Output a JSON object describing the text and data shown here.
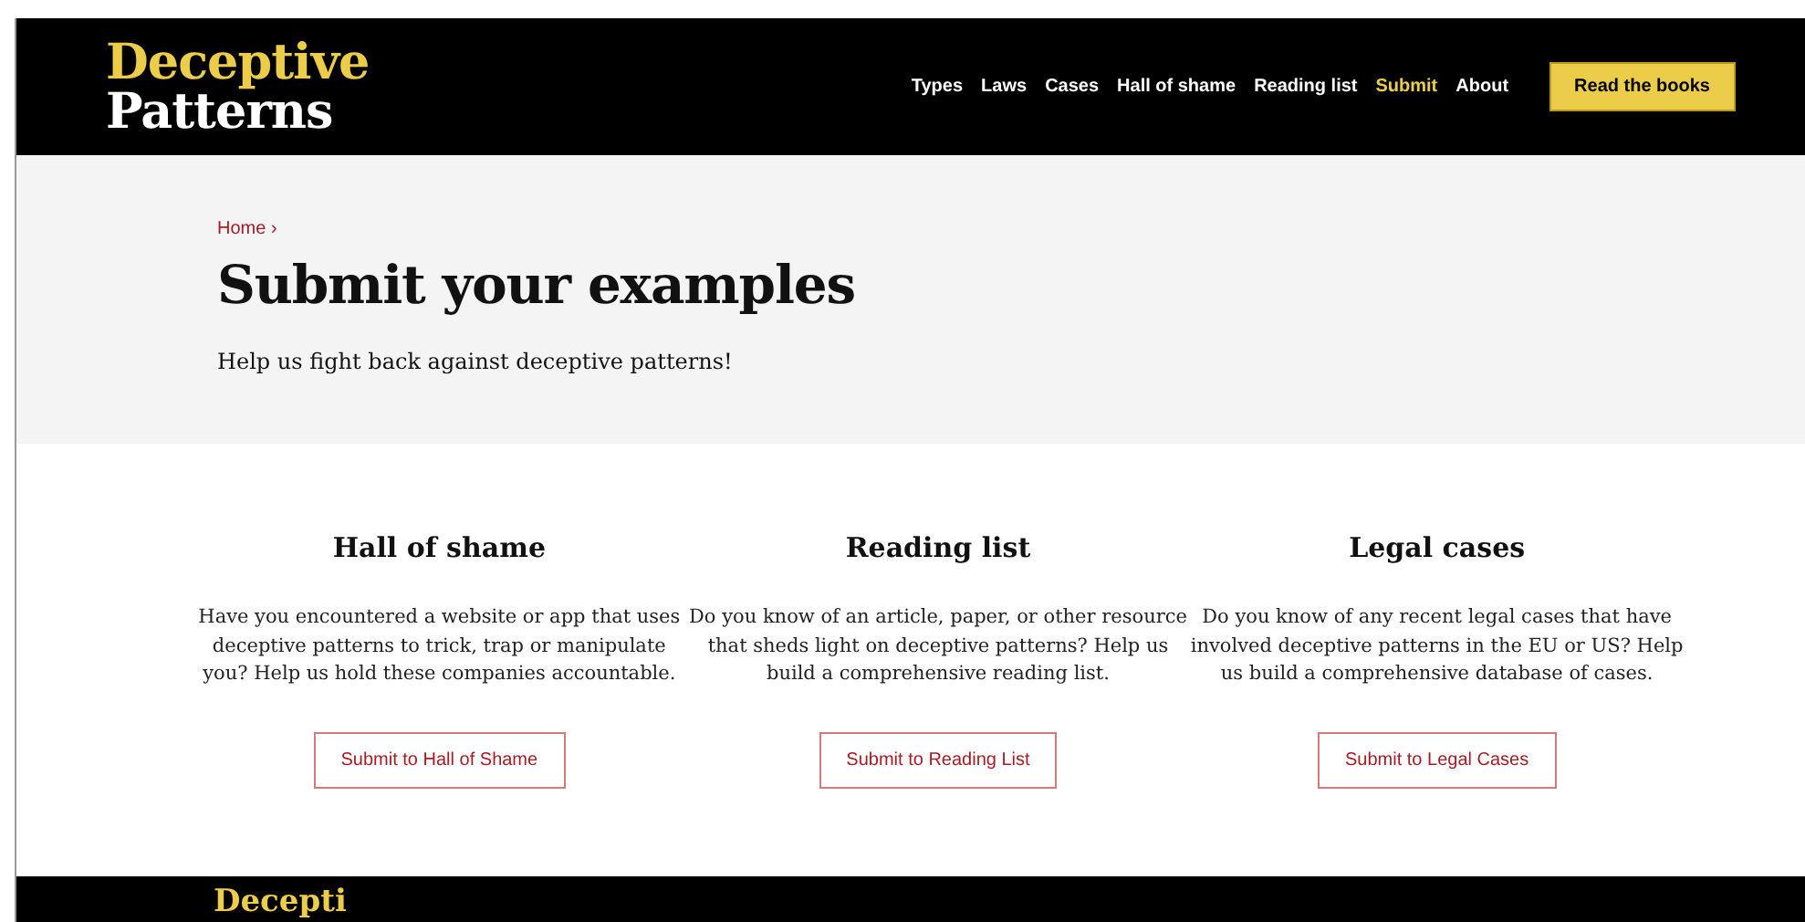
{
  "header": {
    "logo": {
      "line_1": "Deceptive",
      "line_2": "Patterns"
    },
    "nav": [
      {
        "label": "Types",
        "selected": false
      },
      {
        "label": "Laws",
        "selected": false
      },
      {
        "label": "Cases",
        "selected": false
      },
      {
        "label": "Hall of shame",
        "selected": false
      },
      {
        "label": "Reading list",
        "selected": false
      },
      {
        "label": "Submit",
        "selected": true
      },
      {
        "label": "About",
        "selected": false
      }
    ],
    "cta": "Read the books"
  },
  "hero": {
    "breadcrumb": "Home ›",
    "title": "Submit your examples",
    "subtitle": "Help us fight back against deceptive patterns!"
  },
  "cards": [
    {
      "title": "Hall of shame",
      "text": "Have you encountered a website or app that uses deceptive patterns to trick, trap or manipulate you? Help us hold these companies accountable.",
      "button": "Submit to Hall of Shame"
    },
    {
      "title": "Reading list",
      "text": "Do you know of an article, paper, or other resource that sheds light on deceptive patterns? Help us build a comprehensive reading list.",
      "button": "Submit to Reading List"
    },
    {
      "title": "Legal cases",
      "text": "Do you know of any recent legal cases that have involved deceptive patterns in the EU or US? Help us build a comprehensive database of cases.",
      "button": "Submit to Legal Cases"
    }
  ],
  "footer": {
    "logo": "Decepti"
  }
}
